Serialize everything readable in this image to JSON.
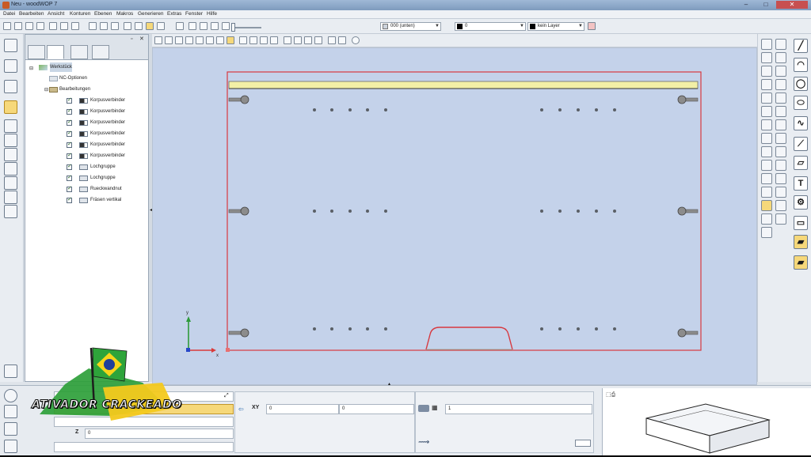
{
  "window": {
    "title": "Neu - woodWOP 7",
    "controls": [
      "–",
      "□",
      "✕"
    ]
  },
  "menu": [
    "Datei",
    "Bearbeiten",
    "Ansicht",
    "Konturen",
    "Ebenen",
    "Makros",
    "Generieren",
    "Extras",
    "Fenster",
    "Hilfe"
  ],
  "toolbar": {
    "plane_select": "000 (unten)",
    "color_select": "0",
    "layer_select": "kein Layer"
  },
  "tree": {
    "root": "Werkstück",
    "nc_options": "NC-Optionen",
    "operations": "Bearbeitungen",
    "items": [
      {
        "label": "Korpusverbinder",
        "icon": "connector-icon"
      },
      {
        "label": "Korpusverbinder",
        "icon": "connector-icon"
      },
      {
        "label": "Korpusverbinder",
        "icon": "connector-icon"
      },
      {
        "label": "Korpusverbinder",
        "icon": "connector-icon"
      },
      {
        "label": "Korpusverbinder",
        "icon": "connector-icon"
      },
      {
        "label": "Korpusverbinder",
        "icon": "connector-icon"
      },
      {
        "label": "Lochgruppe",
        "icon": "hole-group-icon"
      },
      {
        "label": "Lochgruppe",
        "icon": "hole-group-icon"
      },
      {
        "label": "Rueckwandnut",
        "icon": "groove-icon"
      },
      {
        "label": "Fräsen vertikal",
        "icon": "milling-icon"
      }
    ]
  },
  "viewport": {
    "background": "#c4d2ea",
    "outline_color": "#d8383f",
    "strip_color": "#f2efa6",
    "axes": {
      "x": "x",
      "y": "y",
      "x_color": "#d93a3a",
      "y_color": "#2e9a3a",
      "z_color": "#2747c9"
    }
  },
  "props": {
    "xy_label": "XY",
    "xy_x": "0",
    "xy_y": "0",
    "z_label": "Z",
    "z_value": "0",
    "count_value": "1"
  },
  "watermark": {
    "text": "ATIVADOR CRACKEADO"
  }
}
